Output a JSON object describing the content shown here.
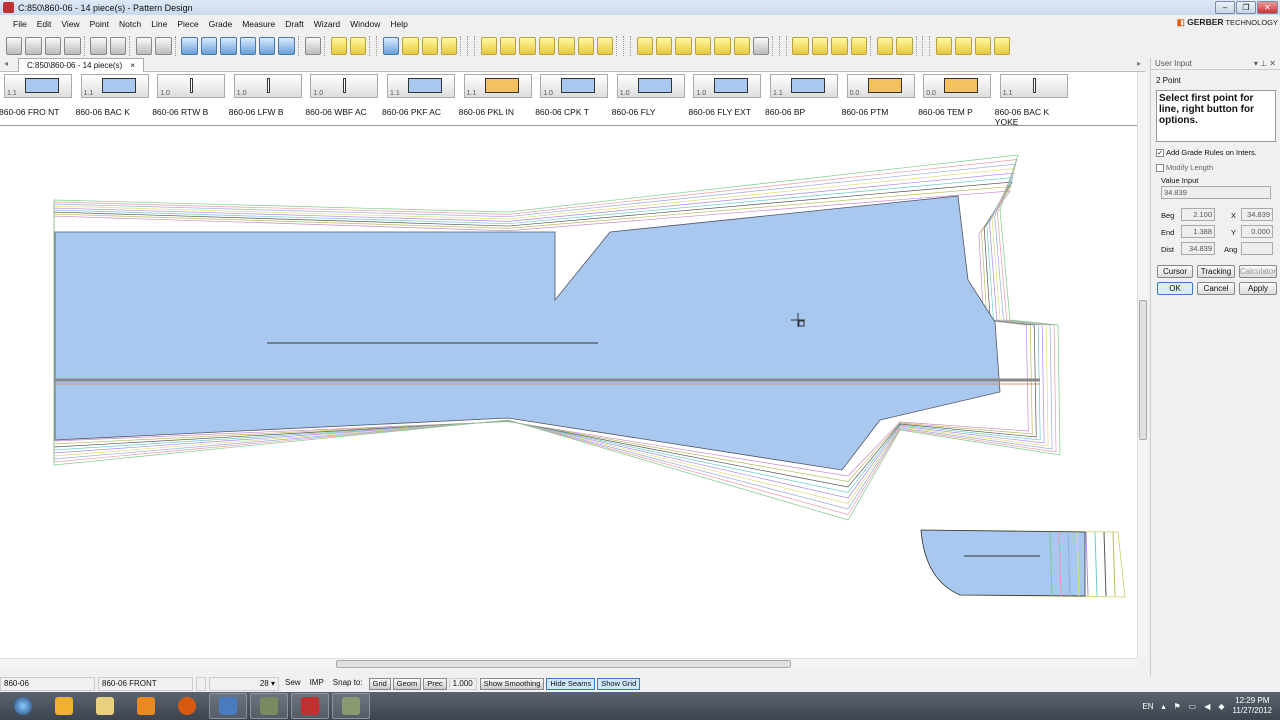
{
  "window": {
    "title": "C:850\\860-06  -  14 piece(s) - Pattern Design",
    "brand_name": "GERBER",
    "brand_suffix": " TECHNOLOGY"
  },
  "menu": [
    "File",
    "Edit",
    "View",
    "Point",
    "Notch",
    "Line",
    "Piece",
    "Grade",
    "Measure",
    "Draft",
    "Wizard",
    "Window",
    "Help"
  ],
  "tab": {
    "label": "C:850\\860-06  -  14 piece(s)",
    "close": "×"
  },
  "pieces": [
    {
      "name": "860-06 FRO NT",
      "size": "1.1"
    },
    {
      "name": "860-06 BAC K",
      "size": "1.1"
    },
    {
      "name": "860-06 RTW B",
      "size": "1.0"
    },
    {
      "name": "860-06 LFW B",
      "size": "1.0"
    },
    {
      "name": "860-06 WBF AC",
      "size": "1.0"
    },
    {
      "name": "860-06 PKF AC",
      "size": "1.1"
    },
    {
      "name": "860-06 PKL IN",
      "size": "1.1"
    },
    {
      "name": "860-06 CPK T",
      "size": "1.0"
    },
    {
      "name": "860-06 FLY",
      "size": "1.0"
    },
    {
      "name": "860-06 FLY EXT",
      "size": "1.0"
    },
    {
      "name": "860-06 BP",
      "size": "1.1"
    },
    {
      "name": "860-06 PTM",
      "size": "0.0"
    },
    {
      "name": "860-06 TEM P",
      "size": "0.0"
    },
    {
      "name": "860-06 BAC K YOKE",
      "size": "1.1"
    }
  ],
  "panel": {
    "title": "User Input",
    "mode": "2 Point",
    "prompt": "Select first point for line, right button for options.",
    "add_grade_rules": "Add Grade Rules on Inters.",
    "add_grade_checked": "✓",
    "modify_length": "Modify Length",
    "value_input_label": "Value Input",
    "value_input": "34.839",
    "beg_label": "Beg",
    "beg": "2.100",
    "end_label": "End",
    "end": "1.388",
    "dist_label": "Dist",
    "dist": "34.839",
    "x_label": "X",
    "x": "34.839",
    "y_label": "Y",
    "y": "0.000",
    "ang_label": "Ang",
    "ang": "",
    "cursor": "Cursor",
    "tracking": "Tracking",
    "calculator": "Calculator",
    "ok": "OK",
    "cancel": "Cancel",
    "apply": "Apply"
  },
  "status": {
    "style": "860-06",
    "piece": "860-06 FRONT",
    "size": "28",
    "sew": "Sew",
    "units": "IMP",
    "snap_to": "Snap to:",
    "grid": "Grid",
    "geom": "Geom",
    "prec": "Prec",
    "prec_value": "1.000",
    "show_smoothing": "Show Smoothing",
    "hide_seams": "Hide Seams",
    "show_grid": "Show Grid"
  },
  "tray": {
    "lang": "EN",
    "time": "12:29 PM",
    "date": "11/27/2012"
  },
  "colors": {
    "piece_fill": "#a8c8f0",
    "accent": "#3a7bc8"
  }
}
